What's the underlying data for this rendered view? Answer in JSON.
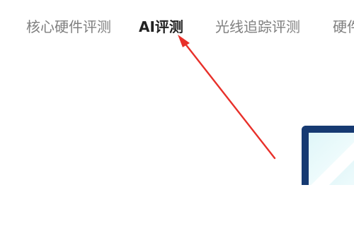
{
  "tabs": [
    {
      "label": "核心硬件评测",
      "active": false
    },
    {
      "label": "AI评测",
      "active": true
    },
    {
      "label": "光线追踪评测",
      "active": false
    },
    {
      "label": "硬件",
      "active": false
    }
  ],
  "colors": {
    "tab_inactive": "#7f7f7f",
    "tab_active": "#222222",
    "annotation_arrow": "#e8302a",
    "device_frame": "#163a72",
    "device_screen": "#dff6f8"
  },
  "annotation": {
    "type": "arrow",
    "points_to": "AI评测"
  },
  "icons": [
    "annotation-arrow",
    "device-illustration"
  ]
}
